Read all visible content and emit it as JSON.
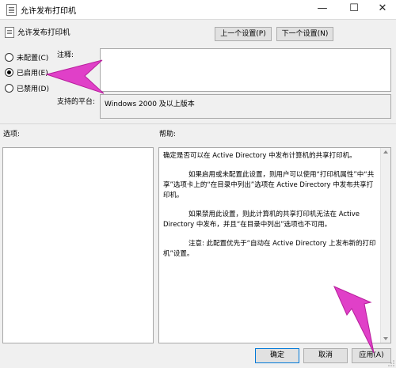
{
  "window": {
    "title": "允许发布打印机",
    "minimize_glyph": "—",
    "maximize_glyph": "☐",
    "close_glyph": "✕"
  },
  "header": {
    "policy_title": "允许发布打印机",
    "prev_button": "上一个设置(P)",
    "next_button": "下一个设置(N)"
  },
  "options": {
    "not_configured": "未配置(C)",
    "enabled": "已启用(E)",
    "disabled": "已禁用(D)",
    "selected": "enabled"
  },
  "comment": {
    "label": "注释:",
    "value": ""
  },
  "platform": {
    "label": "支持的平台:",
    "value": "Windows 2000 及以上版本"
  },
  "sections": {
    "options_label": "选项:",
    "help_label": "帮助:"
  },
  "help": {
    "p1": "确定是否可以在 Active Directory 中发布计算机的共享打印机。",
    "p2": "如果启用或未配置此设置，则用户可以使用“打印机属性”中“共享”选项卡上的“在目录中列出”选项在 Active Directory 中发布共享打印机。",
    "p3": "如果禁用此设置，则此计算机的共享打印机无法在 Active Directory 中发布，并且“在目录中列出”选项也不可用。",
    "p4": "注意: 此配置优先于“自动在 Active Directory 上发布新的打印机”设置。"
  },
  "footer": {
    "ok": "确定",
    "cancel": "取消",
    "apply": "应用(A)"
  },
  "colors": {
    "annotation_pointer": "#e040c8"
  }
}
